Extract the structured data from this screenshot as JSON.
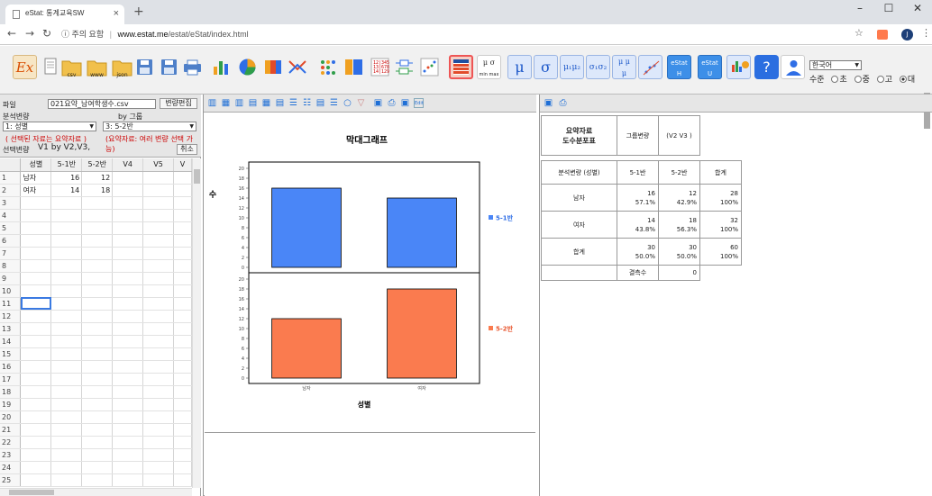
{
  "browser": {
    "tab_title": "eStat: 통계교육SW",
    "tab_close": "×",
    "new_tab": "+",
    "url_warning": "ⓘ 주의 요함",
    "url_host": "www.estat.me",
    "url_path": "/estat/eStat/index.html",
    "avatar_letter": "J"
  },
  "toolbar": {
    "ex_label": "Ex",
    "csv_label": "csv",
    "www_label": "www",
    "json_label": "json",
    "csv2_label": "csv",
    "json2_label": "json",
    "stat1_label": "eStat H",
    "stat2_label": "eStat U",
    "help_label": "?",
    "minmax_label": "min max",
    "language_value": "한국어",
    "level_label": "수준",
    "levels": [
      "초",
      "중",
      "고",
      "대"
    ],
    "level_selected": "대"
  },
  "left": {
    "file_label": "파일",
    "file_value": "021요약_남여학생수.csv",
    "edit_var_button": "변량편집",
    "analysis_var_label": "분석변량",
    "group_label": "by 그룹",
    "analysis_var_value": "1: 성별",
    "group_value": "3: 5-2반",
    "hint1": "( 선택된 자료는 요약자료 )",
    "hint2": "(요약자료: 여러 변량 선택 가능)",
    "selected_var_label": "선택변량",
    "selected_var_value": "V1  by  V2,V3,",
    "cancel_button": "취소"
  },
  "grid": {
    "headers": [
      "성별",
      "5-1반",
      "5-2반",
      "V4",
      "V5",
      "V"
    ],
    "rows": [
      [
        "1",
        "남자",
        "16",
        "12",
        "",
        "",
        ""
      ],
      [
        "2",
        "여자",
        "14",
        "18",
        "",
        "",
        ""
      ],
      [
        "3",
        "",
        "",
        "",
        "",
        "",
        ""
      ],
      [
        "4",
        "",
        "",
        "",
        "",
        "",
        ""
      ],
      [
        "5",
        "",
        "",
        "",
        "",
        "",
        ""
      ],
      [
        "6",
        "",
        "",
        "",
        "",
        "",
        ""
      ],
      [
        "7",
        "",
        "",
        "",
        "",
        "",
        ""
      ],
      [
        "8",
        "",
        "",
        "",
        "",
        "",
        ""
      ],
      [
        "9",
        "",
        "",
        "",
        "",
        "",
        ""
      ],
      [
        "10",
        "",
        "",
        "",
        "",
        "",
        ""
      ],
      [
        "11",
        "",
        "",
        "",
        "",
        "",
        ""
      ],
      [
        "12",
        "",
        "",
        "",
        "",
        "",
        ""
      ],
      [
        "13",
        "",
        "",
        "",
        "",
        "",
        ""
      ],
      [
        "14",
        "",
        "",
        "",
        "",
        "",
        ""
      ],
      [
        "15",
        "",
        "",
        "",
        "",
        "",
        ""
      ],
      [
        "16",
        "",
        "",
        "",
        "",
        "",
        ""
      ],
      [
        "17",
        "",
        "",
        "",
        "",
        "",
        ""
      ],
      [
        "18",
        "",
        "",
        "",
        "",
        "",
        ""
      ],
      [
        "19",
        "",
        "",
        "",
        "",
        "",
        ""
      ],
      [
        "20",
        "",
        "",
        "",
        "",
        "",
        ""
      ],
      [
        "21",
        "",
        "",
        "",
        "",
        "",
        ""
      ],
      [
        "22",
        "",
        "",
        "",
        "",
        "",
        ""
      ],
      [
        "23",
        "",
        "",
        "",
        "",
        "",
        ""
      ],
      [
        "24",
        "",
        "",
        "",
        "",
        "",
        ""
      ],
      [
        "25",
        "",
        "",
        "",
        "",
        "",
        ""
      ]
    ]
  },
  "colors": {
    "series1": "#4a86f7",
    "series2": "#fa7b4f",
    "legend1_text": "#2f6ee6",
    "legend2_text": "#e8552e"
  },
  "chart_data": {
    "type": "bar",
    "title": "막대그래프",
    "xlabel": "성별",
    "ylabel": "수",
    "categories": [
      "남자",
      "여자"
    ],
    "series": [
      {
        "name": "5-1반",
        "values": [
          16,
          14
        ]
      },
      {
        "name": "5-2반",
        "values": [
          12,
          18
        ]
      }
    ],
    "ylim": [
      0,
      20
    ],
    "yticks": [
      0,
      2,
      4,
      6,
      8,
      10,
      12,
      14,
      16,
      18,
      20
    ],
    "legend": "right",
    "layout": "stacked-panels"
  },
  "summary_table": {
    "title_line1": "요약자료",
    "title_line2": "도수분포표",
    "group_var_label": "그룹변량",
    "group_var_value": "(V2 V3 )",
    "analysis_header": "분석변량 (성별)",
    "col1": "5-1반",
    "col2": "5-2반",
    "col_total": "합계",
    "rows": [
      {
        "label": "남자",
        "v1": "16",
        "p1": "57.1%",
        "v2": "12",
        "p2": "42.9%",
        "t": "28",
        "pt": "100%"
      },
      {
        "label": "여자",
        "v1": "14",
        "p1": "43.8%",
        "v2": "18",
        "p2": "56.3%",
        "t": "32",
        "pt": "100%"
      },
      {
        "label": "합계",
        "v1": "30",
        "p1": "50.0%",
        "v2": "30",
        "p2": "50.0%",
        "t": "60",
        "pt": "100%"
      }
    ],
    "missing_label": "결측수",
    "missing_value": "0"
  }
}
